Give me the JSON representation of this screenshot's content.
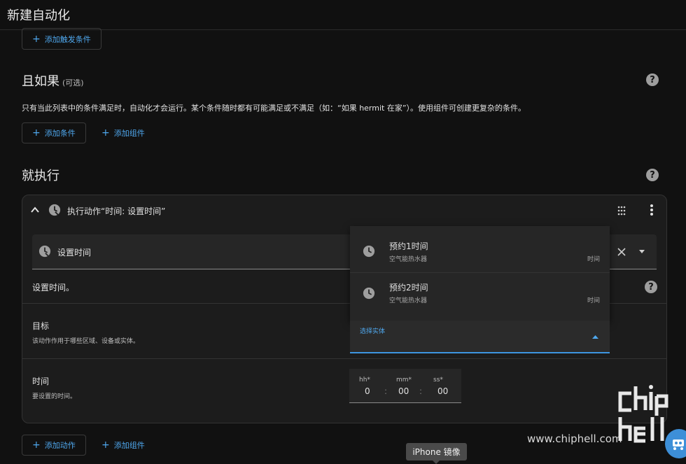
{
  "page_title": "新建自动化",
  "triggers": {
    "add_trigger_label": "添加触发条件"
  },
  "conditions": {
    "title": "且如果",
    "optional": "(可选)",
    "description": "只有当此列表中的条件满足时，自动化才会运行。某个条件随时都有可能满足或不满足（如：“如果 hermit 在家”）。使用组件可创建更复杂的条件。",
    "add_condition_label": "添加条件",
    "add_block_label": "添加组件"
  },
  "actions": {
    "title": "就执行",
    "card_title": "执行动作“时间: 设置时间”",
    "service_field_value": "设置时间",
    "service_description": "设置时间。",
    "target_label": "目标",
    "target_sub": "该动作作用于哪些区域、设备或实体。",
    "time_label": "时间",
    "time_sub": "要设置的时间。",
    "add_action_label": "添加动作",
    "add_block_label": "添加组件"
  },
  "entity_picker": {
    "label": "选择实体",
    "options": [
      {
        "name": "预约1时间",
        "device": "空气能热水器",
        "domain": "时间"
      },
      {
        "name": "预约2时间",
        "device": "空气能热水器",
        "domain": "时间"
      }
    ]
  },
  "time_input": {
    "hh_label": "hh*",
    "mm_label": "mm*",
    "ss_label": "ss*",
    "hh": "0",
    "mm": "00",
    "ss": "00",
    "sep": ":"
  },
  "watermark": {
    "url": "www.chiphell.com",
    "logo": "chip hell"
  },
  "tooltip": "iPhone 镜像",
  "icons": [
    "clock-icon",
    "help-icon",
    "chevron-up-icon",
    "drag-handle-icon",
    "more-vert-icon",
    "close-icon",
    "dropdown-arrow-icon",
    "plus-icon"
  ],
  "colors": {
    "accent": "#4fa8ee",
    "background": "#111111",
    "card": "#1c1c1c"
  }
}
